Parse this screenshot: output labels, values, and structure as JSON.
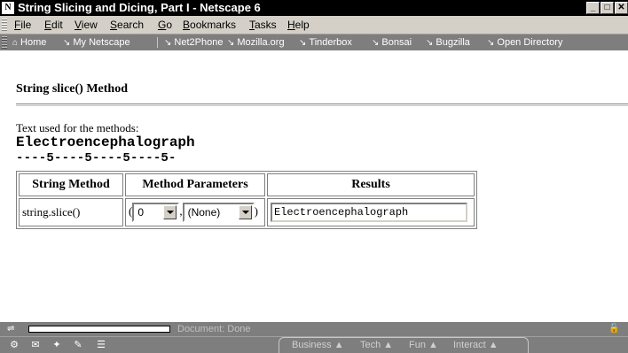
{
  "window": {
    "title": "String Slicing and Dicing, Part I - Netscape 6",
    "app_icon": "N",
    "buttons": [
      "_",
      "□",
      "✕"
    ]
  },
  "menubar": {
    "items": [
      {
        "label": "File",
        "accel": "F",
        "rest": "ile"
      },
      {
        "label": "Edit",
        "accel": "E",
        "rest": "dit"
      },
      {
        "label": "View",
        "accel": "V",
        "rest": "iew"
      },
      {
        "label": "Search",
        "accel": "S",
        "rest": "earch"
      },
      {
        "label": "Go",
        "accel": "G",
        "rest": "o"
      },
      {
        "label": "Bookmarks",
        "accel": "B",
        "rest": "ookmarks"
      },
      {
        "label": "Tasks",
        "accel": "T",
        "rest": "asks"
      },
      {
        "label": "Help",
        "accel": "H",
        "rest": "elp"
      }
    ]
  },
  "personal_toolbar": {
    "items": [
      {
        "label": "Home",
        "icon": "home-icon"
      },
      {
        "label": "My Netscape",
        "icon": "bookmark-icon"
      },
      {
        "label": "Net2Phone",
        "icon": "bookmark-icon"
      },
      {
        "label": "Mozilla.org",
        "icon": "bookmark-icon"
      },
      {
        "label": "Tinderbox",
        "icon": "bookmark-icon"
      },
      {
        "label": "Bonsai",
        "icon": "bookmark-icon"
      },
      {
        "label": "Bugzilla",
        "icon": "bookmark-icon"
      },
      {
        "label": "Open Directory",
        "icon": "bookmark-icon"
      }
    ]
  },
  "page": {
    "heading": "String slice() Method",
    "intro": "Text used for the methods:",
    "sample_text": "Electroencephalograph",
    "ruler": "----5----5----5----5-",
    "table": {
      "headers": [
        "String Method",
        "Method Parameters",
        "Results"
      ],
      "row": {
        "method": "string.slice()",
        "open_paren": "(",
        "comma": ",",
        "close_paren": ")",
        "param1": "0",
        "param2": "(None)",
        "result": "Electroencephalograph"
      }
    }
  },
  "statusbar": {
    "text": "Document: Done"
  },
  "component_bar": {
    "tabs": [
      "Business ▲",
      "Tech ▲",
      "Fun ▲",
      "Interact ▲"
    ]
  }
}
